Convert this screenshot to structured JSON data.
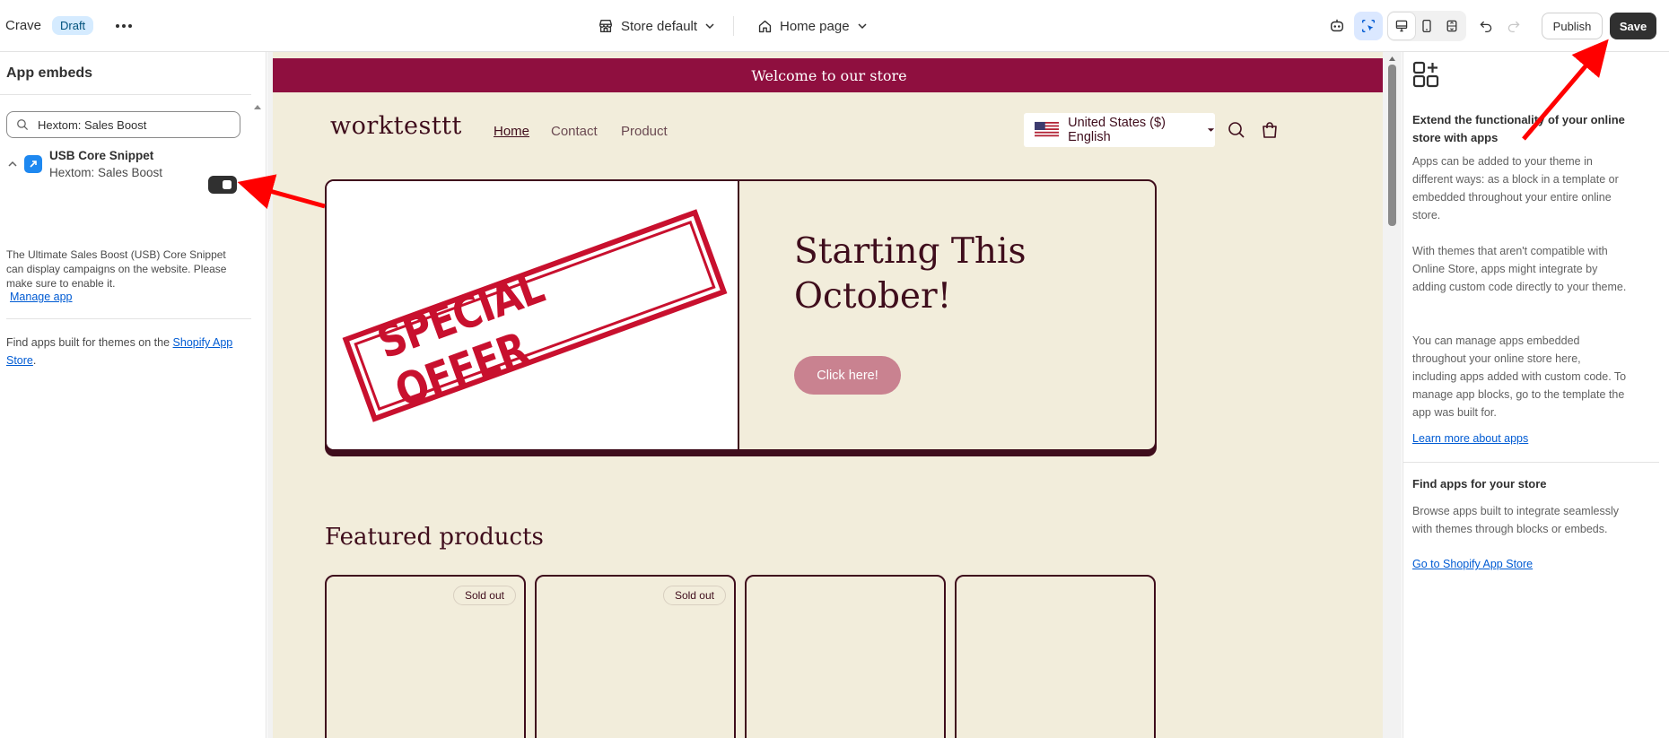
{
  "topbar": {
    "store_name": "Crave",
    "status_badge": "Draft",
    "theme_selector": "Store default",
    "page_selector": "Home page",
    "publish_label": "Publish",
    "save_label": "Save"
  },
  "left": {
    "title": "App embeds",
    "search_value": "Hextom: Sales Boost",
    "embed": {
      "name": "USB Core Snippet",
      "app": "Hextom: Sales Boost",
      "enabled": true
    },
    "description": "The Ultimate Sales Boost (USB) Core Snippet can display campaigns on the website. Please make sure to enable it.",
    "manage_link": "Manage app",
    "find_text": "Find apps built for themes on the ",
    "store_link": "Shopify App Store",
    "find_end": "."
  },
  "preview": {
    "announcement": "Welcome to our store",
    "logo": "worktesttt",
    "nav": [
      "Home",
      "Contact",
      "Product"
    ],
    "locale": "United States ($) English",
    "hero_image_text": "SPECIAL OFFER",
    "hero_heading_1": "Starting This",
    "hero_heading_2": "October!",
    "hero_button": "Click here!",
    "featured_title": "Featured products",
    "sold_out": "Sold out"
  },
  "right": {
    "title": "Extend the functionality of your online store with apps",
    "para1": "Apps can be added to your theme in different ways: as a block in a template or embedded throughout your entire online store.",
    "para2": "With themes that aren't compatible with Online Store, apps might integrate by adding custom code directly to your theme.",
    "para3": "You can manage apps embedded throughout your online store here, including apps added with custom code. To manage app blocks, go to the template the app was built for.",
    "learn_link": "Learn more about apps",
    "find_title": "Find apps for your store",
    "find_para": "Browse apps built to integrate seamlessly with themes through blocks or embeds.",
    "store_link": "Go to Shopify App Store"
  },
  "colors": {
    "announcement_bg": "#8f0f3f",
    "preview_bg": "#f2eddb",
    "text_dark": "#3f0d1c",
    "hero_button_bg": "#c98290",
    "annotation_red": "#ff0000"
  }
}
